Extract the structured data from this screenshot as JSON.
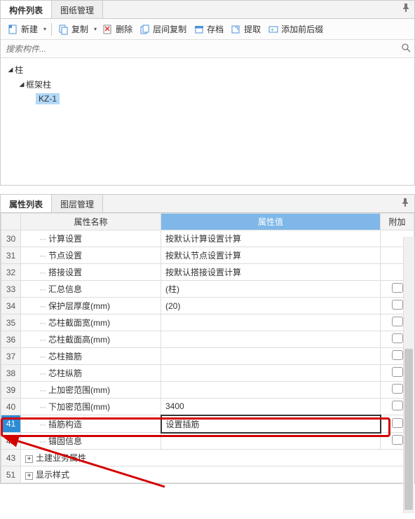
{
  "topPanel": {
    "tabs": [
      {
        "label": "构件列表",
        "active": true
      },
      {
        "label": "图纸管理",
        "active": false
      }
    ],
    "toolbar": {
      "new": "新建",
      "copy": "复制",
      "delete": "删除",
      "layerCopy": "层间复制",
      "archive": "存档",
      "extract": "提取",
      "addPrefixSuffix": "添加前后缀"
    },
    "searchPlaceholder": "搜索构件...",
    "tree": {
      "root": "柱",
      "child": "框架柱",
      "item": "KZ-1"
    }
  },
  "bottomPanel": {
    "tabs": [
      {
        "label": "属性列表",
        "active": true
      },
      {
        "label": "图层管理",
        "active": false
      }
    ],
    "headers": {
      "name": "属性名称",
      "value": "属性值",
      "extra": "附加"
    },
    "rows": [
      {
        "num": "30",
        "name": "计算设置",
        "value": "按默认计算设置计算",
        "check": false
      },
      {
        "num": "31",
        "name": "节点设置",
        "value": "按默认节点设置计算",
        "check": false
      },
      {
        "num": "32",
        "name": "搭接设置",
        "value": "按默认搭接设置计算",
        "check": false
      },
      {
        "num": "33",
        "name": "汇总信息",
        "value": "(柱)",
        "check": true
      },
      {
        "num": "34",
        "name": "保护层厚度(mm)",
        "value": "(20)",
        "check": true
      },
      {
        "num": "35",
        "name": "芯柱截面宽(mm)",
        "value": "",
        "check": true
      },
      {
        "num": "36",
        "name": "芯柱截面高(mm)",
        "value": "",
        "check": true
      },
      {
        "num": "37",
        "name": "芯柱箍筋",
        "value": "",
        "check": true
      },
      {
        "num": "38",
        "name": "芯柱纵筋",
        "value": "",
        "check": true
      },
      {
        "num": "39",
        "name": "上加密范围(mm)",
        "value": "",
        "check": true
      },
      {
        "num": "40",
        "name": "下加密范围(mm)",
        "value": "3400",
        "check": true
      },
      {
        "num": "41",
        "name": "插筋构造",
        "value": "设置插筋",
        "check": true,
        "active": true
      },
      {
        "num": "42",
        "name": "锚固信息",
        "value": "",
        "check": true
      }
    ],
    "groupRows": [
      {
        "num": "43",
        "label": "土建业务属性"
      },
      {
        "num": "51",
        "label": "显示样式"
      }
    ]
  }
}
